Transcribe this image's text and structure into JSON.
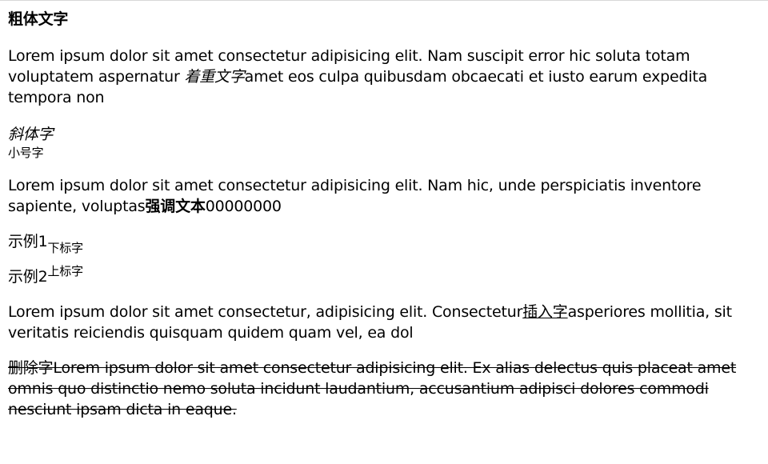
{
  "heading": "粗体文字",
  "para1": {
    "before": "Lorem ipsum dolor sit amet consectetur adipisicing elit. Nam suscipit error hic soluta totam voluptatem aspernatur ",
    "emphasis": "着重文字",
    "after": "amet eos culpa quibusdam obcaecati et iusto earum expedita tempora non"
  },
  "italic_text": "斜体字",
  "small_text": "小号字",
  "para2": {
    "before": "Lorem ipsum dolor sit amet consectetur adipisicing elit. Nam hic, unde perspiciatis inventore sapiente, voluptas",
    "strong": "强调文本",
    "after": "00000000"
  },
  "example1": {
    "base": "示例1",
    "sub": "下标字"
  },
  "example2": {
    "base": "示例2",
    "sup": "上标字"
  },
  "para3": {
    "before": "Lorem ipsum dolor sit amet consectetur, adipisicing elit. Consectetur",
    "inserted": "插入字",
    "after": "asperiores mollitia, sit veritatis reiciendis quisquam quidem quam vel, ea dol"
  },
  "para4": {
    "deleted_label": "删除字",
    "deleted_text": "Lorem ipsum dolor sit amet consectetur adipisicing elit. Ex alias delectus quis placeat amet omnis quo distinctio nemo soluta incidunt laudantium, accusantium adipisci dolores commodi nesciunt ipsam dicta in eaque."
  }
}
